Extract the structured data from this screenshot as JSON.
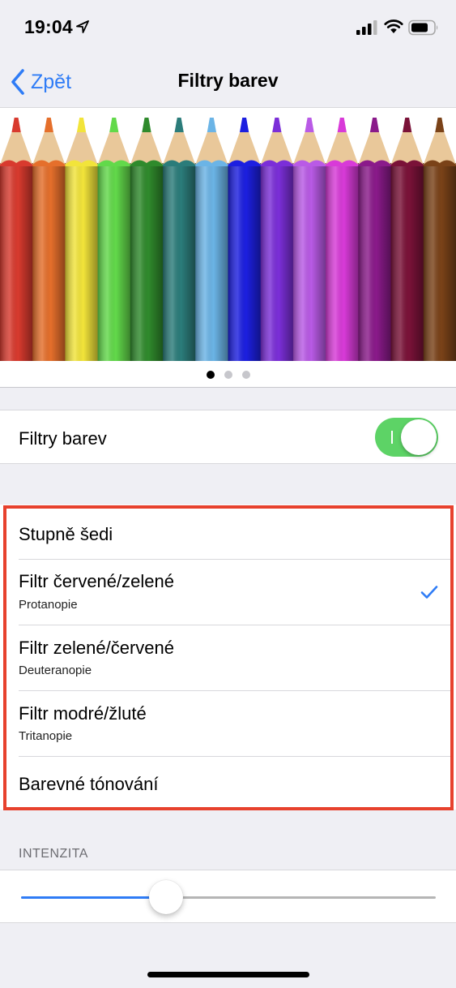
{
  "status_bar": {
    "time": "19:04",
    "icons": [
      "location-arrow-icon",
      "cellular-signal-icon",
      "wifi-icon",
      "battery-icon"
    ]
  },
  "nav": {
    "back_label": "Zpět",
    "title": "Filtry barev"
  },
  "preview": {
    "pencil_colors": [
      "#d83a2e",
      "#e56f2b",
      "#f2e43a",
      "#62d94a",
      "#2f8a2c",
      "#2b7c7a",
      "#6bb4e6",
      "#1c1fe0",
      "#7b2ed8",
      "#b95ae6",
      "#d83ad8",
      "#8a1a8a",
      "#7a1238",
      "#7a4218"
    ],
    "pages": 3,
    "active_page": 1
  },
  "toggle": {
    "label": "Filtry barev",
    "on": true
  },
  "filters": [
    {
      "title": "Stupně šedi",
      "subtitle": "",
      "selected": false
    },
    {
      "title": "Filtr červené/zelené",
      "subtitle": "Protanopie",
      "selected": true
    },
    {
      "title": "Filtr zelené/červené",
      "subtitle": "Deuteranopie",
      "selected": false
    },
    {
      "title": "Filtr modré/žluté",
      "subtitle": "Tritanopie",
      "selected": false
    },
    {
      "title": "Barevné tónování",
      "subtitle": "",
      "selected": false
    }
  ],
  "intensity": {
    "header": "INTENZITA",
    "value": 0.35
  },
  "colors": {
    "accent": "#2f7cf6",
    "switch_on": "#5dd366",
    "highlight_border": "#e7412d",
    "background": "#efeff4"
  }
}
